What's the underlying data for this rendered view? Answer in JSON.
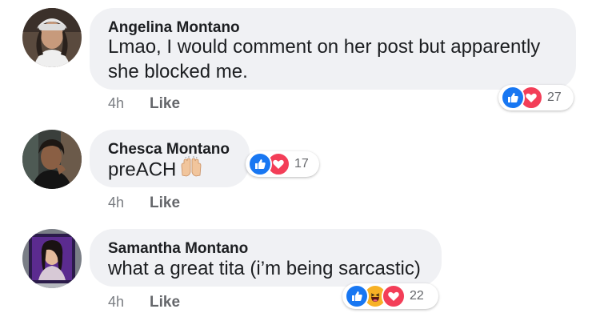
{
  "colors": {
    "bubble": "#f0f1f4",
    "like_blue": "#1877f2",
    "love_red": "#f33e58",
    "haha_yellow": "#f7b125",
    "meta_text": "#65676b"
  },
  "comments": [
    {
      "author": "Angelina Montano",
      "text_line1": "Lmao, I would comment on her post but apparently",
      "text_line2": "she blocked me.",
      "time": "4h",
      "like_label": "Like",
      "reactions": [
        "like-icon",
        "love-icon"
      ],
      "reaction_count": "27"
    },
    {
      "author": "Chesca Montano",
      "text": "preACH",
      "emoji": "raising-hands-emoji",
      "time": "4h",
      "like_label": "Like",
      "reactions": [
        "like-icon",
        "love-icon"
      ],
      "reaction_count": "17"
    },
    {
      "author": "Samantha Montano",
      "text": "what a great tita (i’m being sarcastic)",
      "time": "4h",
      "like_label": "Like",
      "reactions": [
        "like-icon",
        "haha-icon",
        "love-icon"
      ],
      "reaction_count": "22"
    }
  ]
}
